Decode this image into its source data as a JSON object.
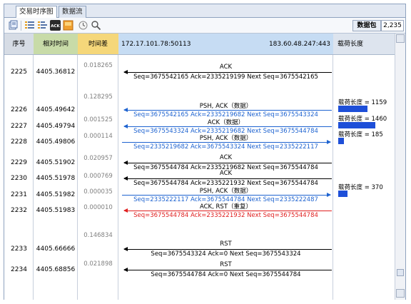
{
  "tabs": [
    {
      "label": "交易时序图",
      "active": true
    },
    {
      "label": "数据流",
      "active": false
    }
  ],
  "toolbar": {
    "icons": [
      "export-icon",
      "list-icon",
      "list-detail-icon",
      "ack-icon",
      "highlight-icon",
      "clock-icon",
      "search-icon"
    ],
    "packet_label": "数据包",
    "packet_count": "2,235"
  },
  "headers": {
    "seq": "序号",
    "time": "相对时间",
    "delta": "时间差",
    "src": "172.17.101.78:50113",
    "dst": "183.60.48.247:443",
    "payload": "载荷长度"
  },
  "header_colors": {
    "seq": "#d6dce5",
    "time": "#c8dba8",
    "delta": "#f5d77a",
    "flow": "#c6dcf3",
    "payload": "#dde4ee"
  },
  "rows": [
    {
      "seq": "2225",
      "time": "4405.36812",
      "delta_before": "0.018265",
      "title": "ACK",
      "detail": "Seq=3675542165  Ack=2335219199  Next Seq=3675542165",
      "dir": "left",
      "color": "#000000",
      "payload_label": "",
      "payload_bar": 0
    },
    {
      "seq": "2226",
      "time": "4405.49642",
      "delta_before": "0.128295",
      "title": "PSH, ACK（数据）",
      "detail": "Seq=3675542165  Ack=2335219682  Next Seq=3675543324",
      "dir": "left",
      "color": "#1e63d0",
      "payload_label": "载荷长度 = 1159",
      "payload_bar": 1159
    },
    {
      "seq": "2227",
      "time": "4405.49794",
      "delta_before": "0.001525",
      "title": "ACK（数据）",
      "detail": "Seq=3675543324  Ack=2335219682  Next Seq=3675544784",
      "dir": "left",
      "color": "#1e63d0",
      "payload_label": "载荷长度 = 1460",
      "payload_bar": 1460
    },
    {
      "seq": "2228",
      "time": "4405.49806",
      "delta_before": "0.000114",
      "title": "PSH, ACK（数据）",
      "detail": "Seq=2335219682  Ack=3675543324  Next Seq=2335222117",
      "dir": "right",
      "color": "#1e63d0",
      "payload_label": "载荷长度 = 185",
      "payload_bar": 185
    },
    {
      "seq": "2229",
      "time": "4405.51902",
      "delta_before": "0.020957",
      "title": "ACK",
      "detail": "Seq=3675544784  Ack=2335219682  Next Seq=3675544784",
      "dir": "left",
      "color": "#000000",
      "payload_label": "",
      "payload_bar": 0
    },
    {
      "seq": "2230",
      "time": "4405.51978",
      "delta_before": "0.000769",
      "title": "ACK",
      "detail": "Seq=3675544784  Ack=2335221932  Next Seq=3675544784",
      "dir": "left",
      "color": "#000000",
      "payload_label": "",
      "payload_bar": 0
    },
    {
      "seq": "2231",
      "time": "4405.51982",
      "delta_before": "0.000035",
      "title": "PSH, ACK（数据）",
      "detail": "Seq=2335222117  Ack=3675544784  Next Seq=2335222487",
      "dir": "right",
      "color": "#1e63d0",
      "payload_label": "载荷长度 = 370",
      "payload_bar": 370
    },
    {
      "seq": "2232",
      "time": "4405.51983",
      "delta_before": "0.000010",
      "title": "ACK, RST（重复）",
      "detail": "Seq=3675544784  Ack=2335221932  Next Seq=3675544784",
      "dir": "left",
      "color": "#e02020",
      "payload_label": "",
      "payload_bar": 0
    },
    {
      "seq": "2233",
      "time": "4405.66666",
      "delta_before": "0.146834",
      "title": "RST",
      "detail": "Seq=3675543324  Ack=0  Next Seq=3675543324",
      "dir": "left",
      "color": "#000000",
      "payload_label": "",
      "payload_bar": 0
    },
    {
      "seq": "2234",
      "time": "4405.68856",
      "delta_before": "0.021898",
      "title": "RST",
      "detail": "Seq=3675544784  Ack=0  Next Seq=3675544784",
      "dir": "left",
      "color": "#000000",
      "payload_label": "",
      "payload_bar": 0
    }
  ]
}
